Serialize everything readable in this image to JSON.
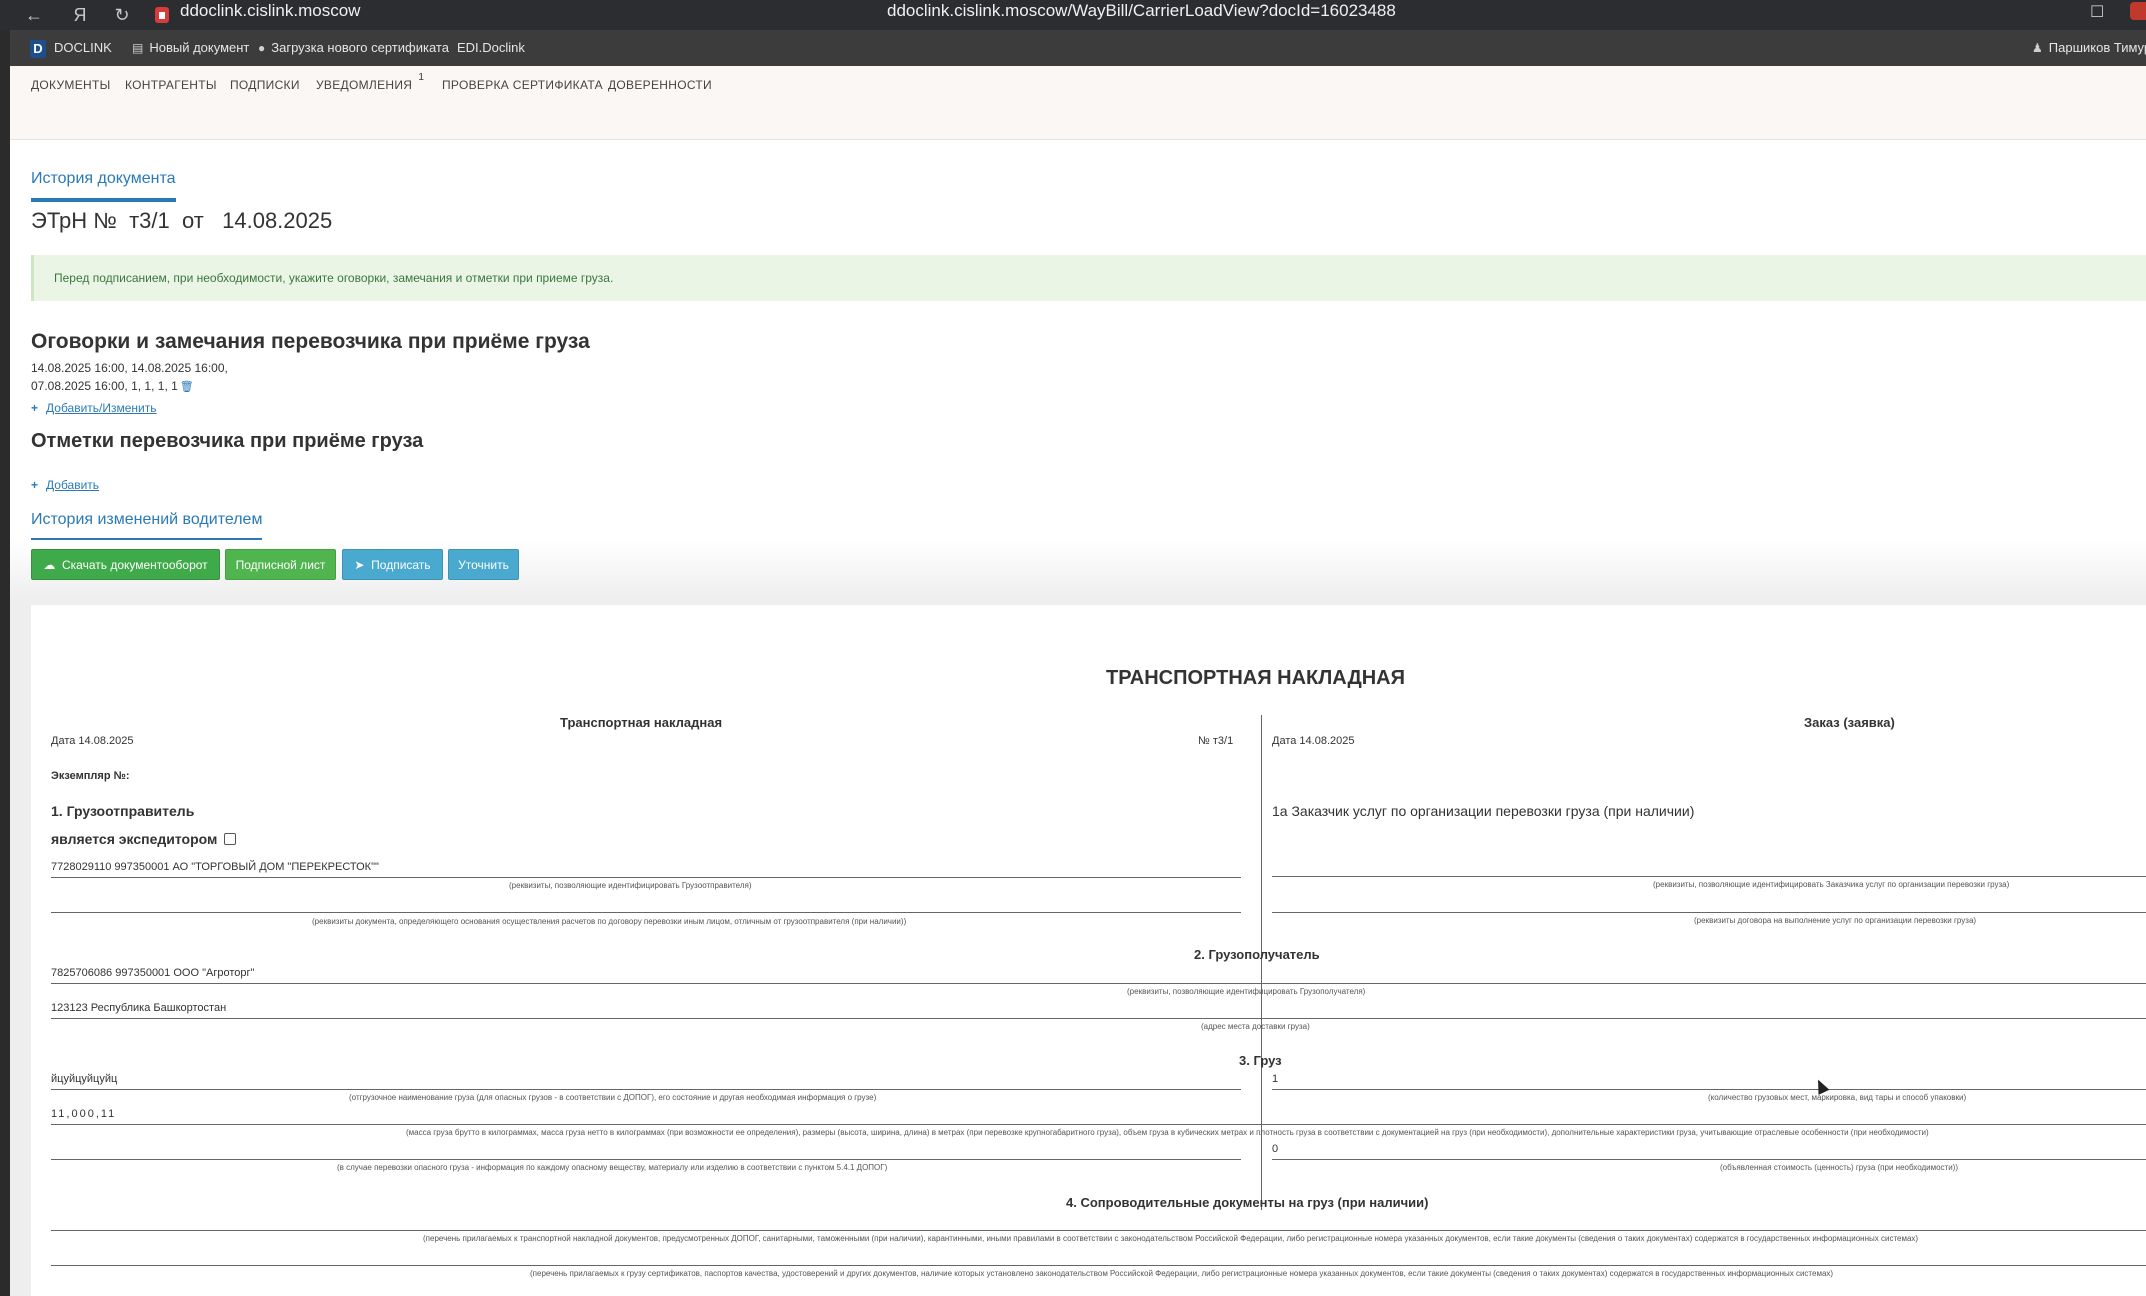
{
  "browser": {
    "host": "ddoclink.cislink.moscow",
    "url": "ddoclink.cislink.moscow/WayBill/CarrierLoadView?docId=16023488"
  },
  "header": {
    "logo_letter": "D",
    "brand": "DOCLINK",
    "new_doc": "Новый документ",
    "upload_cert": "Загрузка нового сертификата",
    "edi": "EDI.Doclink",
    "user": "Паршиков Тимур"
  },
  "menu": {
    "documents": "ДОКУМЕНТЫ",
    "contragents": "КОНТРАГЕНТЫ",
    "signatures": "ПОДПИСКИ",
    "notifications": "УВЕДОМЛЕНИЯ",
    "notifications_badge": "1",
    "check_cert": "ПРОВЕРКА СЕРТИФИКАТА",
    "powers": "ДОВЕРЕННОСТИ"
  },
  "page": {
    "history_link": "История документа",
    "doc_title": "ЭТрН №  т3/1  от   14.08.2025",
    "alert": "Перед подписанием, при необходимости, укажите оговорки, замечания и отметки при приеме груза.",
    "reservations_title": "Оговорки и замечания перевозчика при приёме груза",
    "reservations_line1": "14.08.2025  16:00, 14.08.2025  16:00,",
    "reservations_line2": "07.08.2025  16:00, 1, 1, 1, 1",
    "add_edit": "Добавить/Изменить",
    "marks_title": "Отметки перевозчика при приёме груза",
    "add": "Добавить",
    "driver_history": "История изменений водителем",
    "btn_download": "Скачать документооборот",
    "btn_sign_sheet": "Подписной лист",
    "btn_sign": "Подписать",
    "btn_clarify": "Уточнить"
  },
  "doc": {
    "main_title": "ТРАНСПОРТНАЯ НАКЛАДНАЯ",
    "left_header": "Транспортная накладная",
    "right_header": "Заказ (заявка)",
    "date_left": "Дата  14.08.2025",
    "number": "№   т3/1",
    "date_right": "Дата 14.08.2025",
    "copy_no": "Экземпляр №:",
    "s1_title": "1. Грузоотправитель",
    "is_forwarder": "является экспедитором",
    "sender": "7728029110 997350001 АО \"ТОРГОВЫЙ ДОМ \"ПЕРЕКРЕСТОК\"\"",
    "sender_caption": "(реквизиты, позволяющие идентифицировать Грузоотправителя)",
    "sender_doc_caption": "(реквизиты документа, определяющего основания осуществления расчетов по договору перевозки иным лицом, отличным от грузоотправителя (при наличии))",
    "s1a_title": "1а Заказчик услуг по организации перевозки груза (при наличии)",
    "customer_caption": "(реквизиты, позволяющие идентифицировать Заказчика услуг по организации перевозки груза)",
    "contract_caption": "(реквизиты договора на выполнение услуг по организации перевозки груза)",
    "s2_title": "2. Грузополучатель",
    "receiver": "7825706086 997350001 ООО \"Агроторг\"",
    "receiver_caption": "(реквизиты, позволяющие идентифицировать Грузополучателя)",
    "address": "123123 Республика Башкортостан",
    "address_caption": "(адрес места доставки груза)",
    "s3_title": "3. Груз",
    "cargo_name": "йцуйцуйцуйц",
    "cargo_name_caption": "(отгрузочное наименование груза (для опасных грузов - в соответствии с ДОПОГ), его состояние и другая необходимая информация о грузе)",
    "places": "1",
    "places_caption": "(количество грузовых мест, маркировка, вид тары и способ упаковки)",
    "mass": "11,000,11",
    "mass_caption": "(масса груза брутто в килограммах, масса груза нетто в килограммах (при возможности ее определения), размеры (высота, ширина, длина) в метрах (при перевозке крупногабаритного груза), объем груза в кубических метрах и плотность груза в соответствии с документацией на груз (при необходимости), дополнительные характеристики груза, учитывающие отраслевые особенности (при необходимости)",
    "danger_caption": "(в случае перевозки опасного груза - информация по каждому опасному веществу, материалу или изделию в соответствии с пунктом 5.4.1 ДОПОГ)",
    "declared_value": "0",
    "declared_value_caption": "(объявленная стоимость (ценность) груза (при необходимости))",
    "s4_title": "4. Сопроводительные документы на груз (при наличии)",
    "docs_caption1": "(перечень прилагаемых к транспортной накладной документов, предусмотренных ДОПОГ, санитарными, таможенными (при наличии), карантинными, иными правилами в соответствии с законодательством Российской Федерации, либо регистрационные номера указанных документов, если такие документы (сведения о таких документах) содержатся в государственных информационных системах)",
    "docs_caption2": "(перечень прилагаемых к грузу сертификатов, паспортов качества, удостоверений и других документов, наличие которых установлено законодательством Российской Федерации, либо регистрационные номера указанных документов, если такие документы (сведения о таких документах) содержатся в государственных информационных системах)"
  }
}
